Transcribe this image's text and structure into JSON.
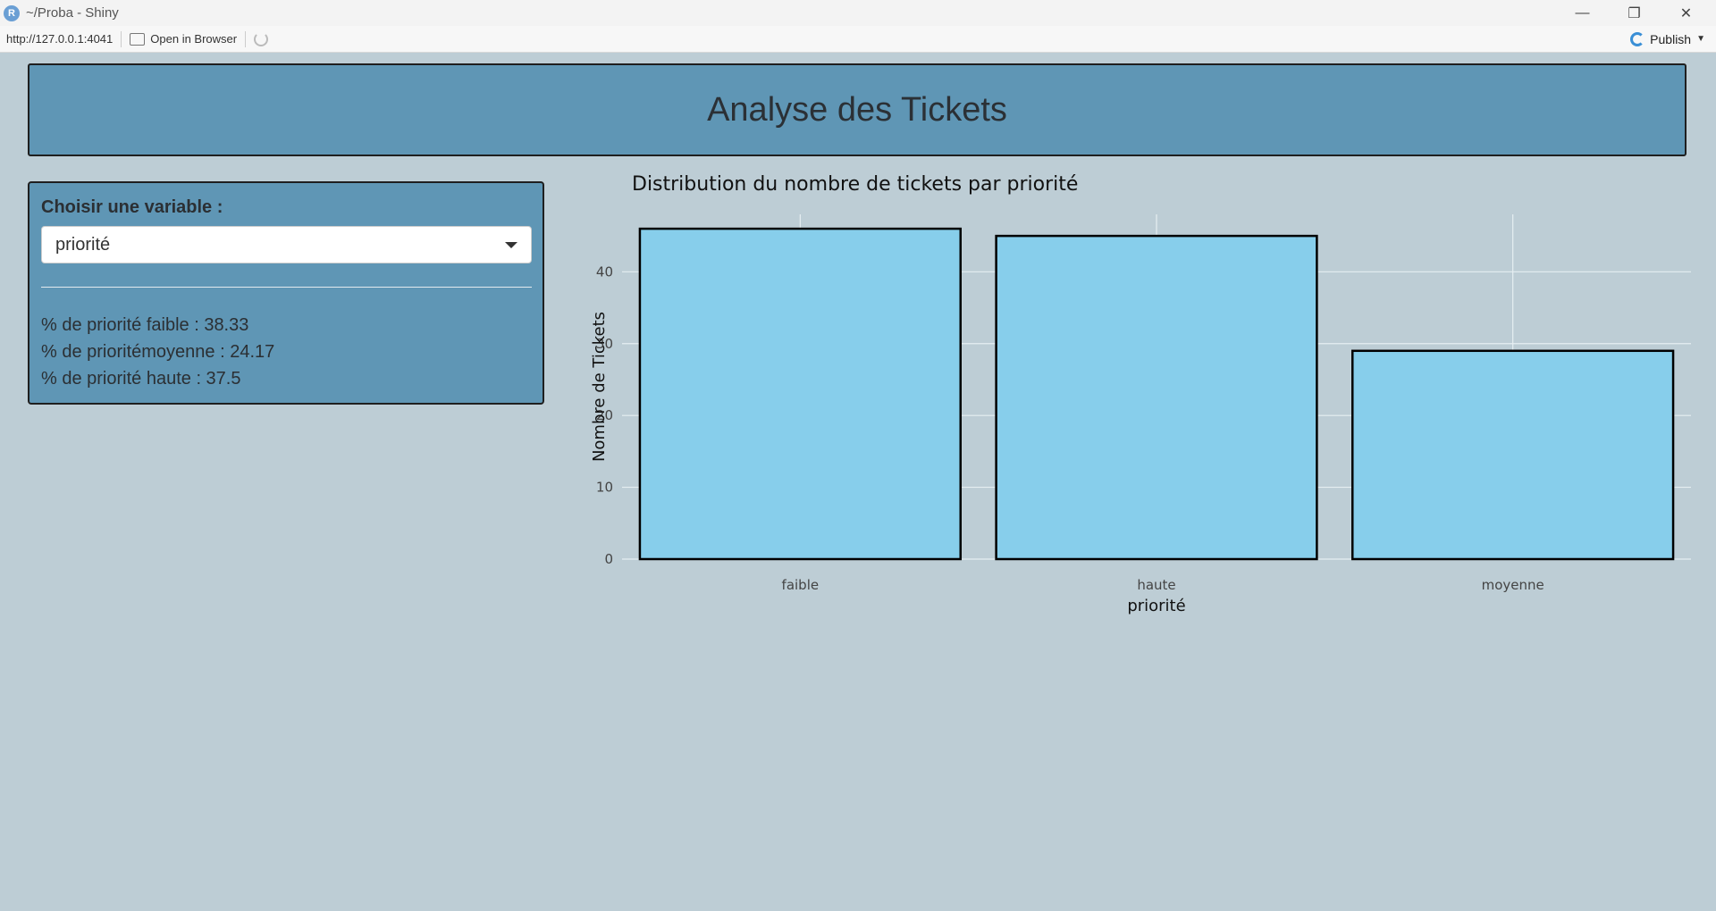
{
  "window": {
    "title": "~/Proba - Shiny",
    "app_icon": "R",
    "controls": {
      "minimize": "—",
      "restore": "❐",
      "close": "✕"
    }
  },
  "toolbar": {
    "url": "http://127.0.0.1:4041",
    "open_in_browser": "Open in Browser",
    "publish": "Publish"
  },
  "app": {
    "title": "Analyse des Tickets",
    "sidebar": {
      "select_label": "Choisir une variable :",
      "selected_value": "priorité",
      "stats": [
        "% de priorité faible : 38.33",
        "% de prioritémoyenne : 24.17",
        "% de priorité haute : 37.5"
      ]
    }
  },
  "chart_data": {
    "type": "bar",
    "title": "Distribution du nombre de tickets par priorité",
    "xlabel": "priorité",
    "ylabel": "Nombre de Tickets",
    "categories": [
      "faible",
      "haute",
      "moyenne"
    ],
    "values": [
      46,
      45,
      29
    ],
    "ylim": [
      0,
      48
    ],
    "yticks": [
      0,
      10,
      20,
      30,
      40
    ],
    "bar_color": "#87ceeb",
    "bar_outline": "#000000",
    "grid": true
  },
  "colors": {
    "background": "#bdcdd5",
    "panel": "#5f96b5"
  }
}
